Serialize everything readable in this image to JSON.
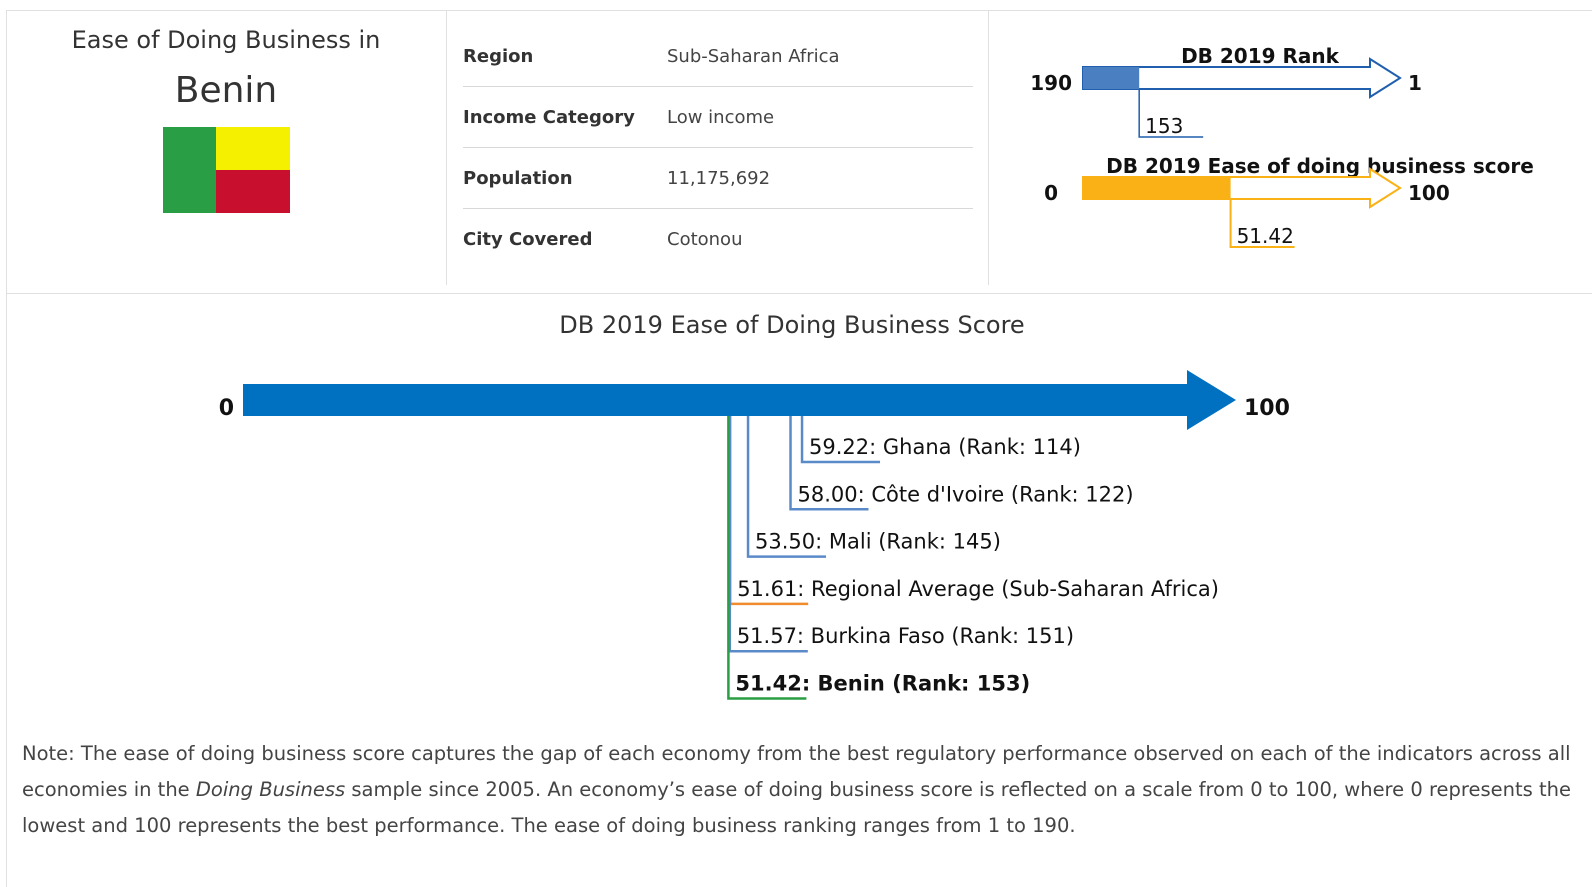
{
  "country": {
    "caption": "Ease of Doing Business in",
    "name": "Benin",
    "flag_colors": {
      "hoist": "#2a9e44",
      "top": "#f5f000",
      "bottom": "#c8102e"
    }
  },
  "info": [
    {
      "label": "Region",
      "value": "Sub-Saharan Africa"
    },
    {
      "label": "Income Category",
      "value": "Low income"
    },
    {
      "label": "Population",
      "value": "11,175,692"
    },
    {
      "label": "City Covered",
      "value": "Cotonou"
    }
  ],
  "rank_gauge": {
    "title": "DB 2019 Rank",
    "worst": "190",
    "best": "1",
    "value": 153,
    "value_label": "153",
    "color": "#1f5fae",
    "fill_color": "#4a7fc1"
  },
  "score_gauge": {
    "title": "DB 2019 Ease of doing business score",
    "min": "0",
    "max": "100",
    "value": 51.42,
    "value_label": "51.42",
    "color": "#f9b115"
  },
  "chart_data": {
    "type": "scatter",
    "title": "DB 2019 Ease of Doing Business Score",
    "axis_min_label": "0",
    "axis_max_label": "100",
    "xlim": [
      0,
      100
    ],
    "axis_color": "#0070c0",
    "points": [
      {
        "x": 59.22,
        "label": "59.22: Ghana (Rank: 114)",
        "color": "#5b8ac9",
        "bold": false
      },
      {
        "x": 58.0,
        "label": "58.00: Côte d'Ivoire (Rank: 122)",
        "color": "#5b8ac9",
        "bold": false
      },
      {
        "x": 53.5,
        "label": "53.50: Mali (Rank: 145)",
        "color": "#5b8ac9",
        "bold": false
      },
      {
        "x": 51.61,
        "label": "51.61: Regional Average (Sub-Saharan Africa)",
        "color": "#f08c2e",
        "bold": false
      },
      {
        "x": 51.57,
        "label": "51.57: Burkina Faso (Rank: 151)",
        "color": "#5b8ac9",
        "bold": false
      },
      {
        "x": 51.42,
        "label": "51.42: Benin (Rank: 153)",
        "color": "#2a9e44",
        "bold": true
      }
    ]
  },
  "note": {
    "before": "Note: The ease of doing business score captures the gap of each economy from the best regulatory performance observed on each of the indicators across all economies in the ",
    "italic": "Doing Business",
    "after": " sample since 2005. An economy’s ease of doing business score is reflected on a scale from 0 to 100, where 0 represents the lowest and 100 represents the best performance. The ease of doing business ranking ranges from 1 to 190."
  }
}
